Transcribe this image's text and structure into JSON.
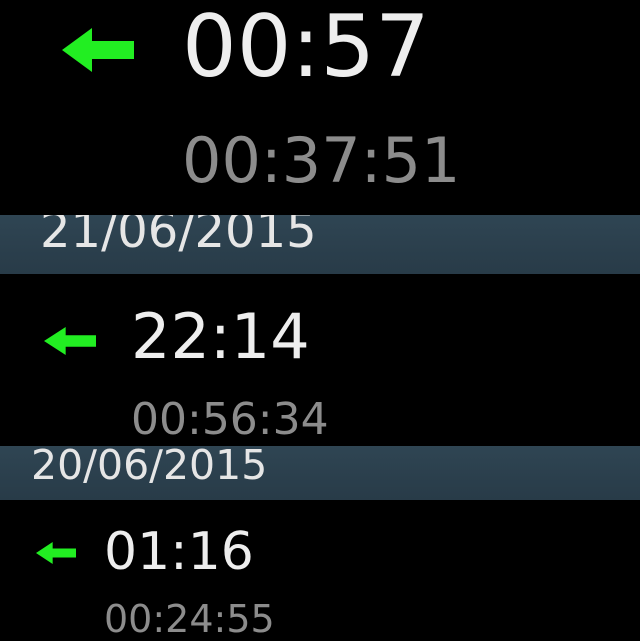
{
  "colors": {
    "background": "#000000",
    "arrow": "#22ee22",
    "time_text": "#eeeeee",
    "duration_text": "#8c8c8c",
    "header_background": "#2c414f",
    "header_text": "#e6e6e6"
  },
  "call_log": {
    "entries": [
      {
        "icon": "incoming-arrow-icon",
        "time": "00:57",
        "duration": "00:37:51"
      },
      {
        "icon": "incoming-arrow-icon",
        "time": "22:14",
        "duration": "00:56:34"
      },
      {
        "icon": "incoming-arrow-icon",
        "time": "01:16",
        "duration": "00:24:55"
      }
    ],
    "date_headers": [
      {
        "date": "21/06/2015"
      },
      {
        "date": "20/06/2015"
      }
    ]
  }
}
